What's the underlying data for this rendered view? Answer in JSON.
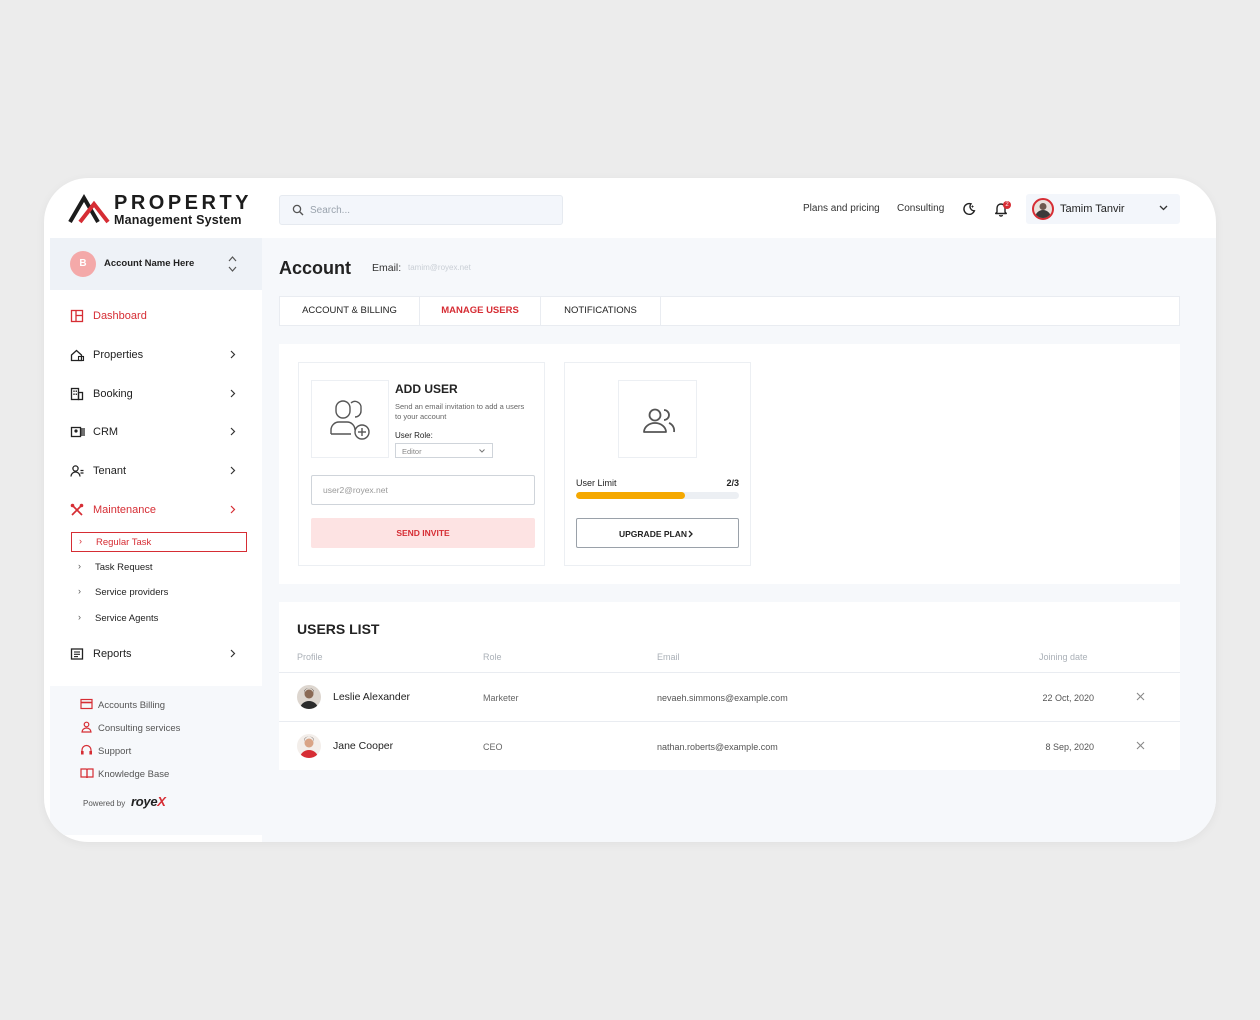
{
  "header": {
    "logo_word": "PROPERTY",
    "logo_sub": "Management System",
    "search_placeholder": "Search...",
    "links": [
      "Plans and pricing",
      "Consulting"
    ],
    "notification_count": "2",
    "user_name": "Tamim Tanvir"
  },
  "sidebar": {
    "account_initial": "B",
    "account_name": "Account Name Here",
    "nav": [
      {
        "label": "Dashboard",
        "icon": "dashboard-icon"
      },
      {
        "label": "Properties",
        "icon": "property-icon"
      },
      {
        "label": "Booking",
        "icon": "building-icon"
      },
      {
        "label": "CRM",
        "icon": "crm-icon"
      },
      {
        "label": "Tenant",
        "icon": "tenant-icon"
      },
      {
        "label": "Maintenance",
        "icon": "tools-icon"
      },
      {
        "label": "Reports",
        "icon": "report-icon"
      }
    ],
    "maintenance_sub": [
      "Regular Task",
      "Task Request",
      "Service providers",
      "Service Agents"
    ],
    "bottom": [
      {
        "label": "Accounts Billing",
        "icon": "card-icon"
      },
      {
        "label": "Consulting services",
        "icon": "person-icon"
      },
      {
        "label": "Support",
        "icon": "headset-icon"
      },
      {
        "label": "Knowledge Base",
        "icon": "book-icon"
      }
    ],
    "powered_by": "Powered by",
    "brand_main": "roye",
    "brand_x": "X"
  },
  "account": {
    "title": "Account",
    "email_label": "Email:",
    "email_value": "tamim@royex.net",
    "tabs": [
      "ACCOUNT & BILLING",
      "MANAGE USERS",
      "NOTIFICATIONS"
    ],
    "active_tab": "MANAGE USERS"
  },
  "add_user": {
    "title": "ADD USER",
    "description": "Send an email invitation to add a users to your account",
    "role_label": "User Role:",
    "role_value": "Editor",
    "email_value": "user2@royex.net",
    "send_button": "SEND INVITE"
  },
  "user_limit": {
    "label": "User Limit",
    "value": "2/3",
    "used": 2,
    "max": 3,
    "upgrade_button": "UPGRADE PLAN"
  },
  "users_list": {
    "title": "USERS LIST",
    "columns": [
      "Profile",
      "Role",
      "Email",
      "Joining date"
    ],
    "rows": [
      {
        "name": "Leslie Alexander",
        "role": "Marketer",
        "email": "nevaeh.simmons@example.com",
        "date": "22 Oct, 2020"
      },
      {
        "name": "Jane Cooper",
        "role": "CEO",
        "email": "nathan.roberts@example.com",
        "date": "8 Sep, 2020"
      }
    ]
  },
  "colors": {
    "accent": "#d62d34",
    "progress": "#f5a800",
    "background": "#f6f8fb"
  }
}
